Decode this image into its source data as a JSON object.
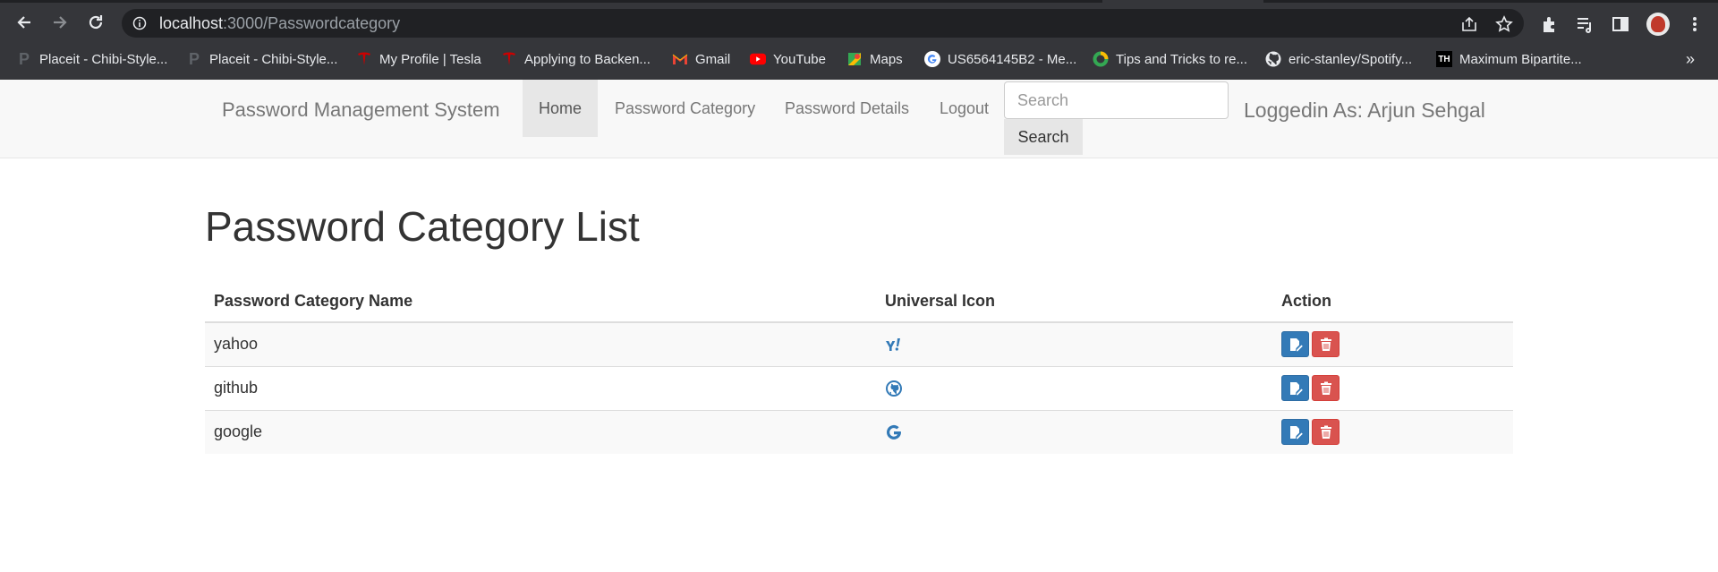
{
  "browser": {
    "url_host": "localhost",
    "url_rest": ":3000/Passwordcategory",
    "bookmarks": [
      {
        "label": "Placeit - Chibi-Style...",
        "icon": "placeit-icon"
      },
      {
        "label": "Placeit - Chibi-Style...",
        "icon": "placeit-icon"
      },
      {
        "label": "My Profile | Tesla",
        "icon": "tesla-icon"
      },
      {
        "label": "Applying to Backen...",
        "icon": "tesla-icon"
      },
      {
        "label": "Gmail",
        "icon": "gmail-icon"
      },
      {
        "label": "YouTube",
        "icon": "youtube-icon"
      },
      {
        "label": "Maps",
        "icon": "maps-icon"
      },
      {
        "label": "US6564145B2 - Me...",
        "icon": "google-icon"
      },
      {
        "label": "Tips and Tricks to re...",
        "icon": "ring-icon"
      },
      {
        "label": "eric-stanley/Spotify...",
        "icon": "github-icon"
      },
      {
        "label": "Maximum Bipartite...",
        "icon": "th-icon"
      }
    ],
    "more": "»",
    "th_glyph": "TH"
  },
  "navbar": {
    "brand": "Password Management System",
    "items": [
      {
        "label": "Home",
        "active": true
      },
      {
        "label": "Password Category",
        "active": false
      },
      {
        "label": "Password Details",
        "active": false
      },
      {
        "label": "Logout",
        "active": false
      }
    ],
    "search_placeholder": "Search",
    "search_button": "Search",
    "logged_in": "Loggedin As: Arjun Sehgal"
  },
  "page": {
    "title": "Password Category List",
    "columns": [
      "Password Category Name",
      "Universal Icon",
      "Action"
    ],
    "rows": [
      {
        "name": "yahoo",
        "icon": "yahoo-icon"
      },
      {
        "name": "github",
        "icon": "github-icon"
      },
      {
        "name": "google",
        "icon": "google-icon"
      }
    ]
  },
  "colors": {
    "edit_button": "#337ab7",
    "delete_button": "#d9534f",
    "icon_blue": "#337ab7"
  }
}
